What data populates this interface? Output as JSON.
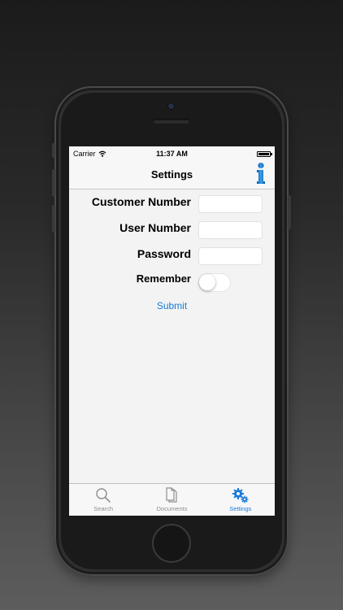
{
  "status": {
    "carrier": "Carrier",
    "time": "11:37 AM"
  },
  "nav": {
    "title": "Settings",
    "info_icon": "info-icon"
  },
  "form": {
    "customer_label": "Customer Number",
    "customer_value": "",
    "user_label": "User Number",
    "user_value": "",
    "password_label": "Password",
    "password_value": "",
    "remember_label": "Remember",
    "remember_on": false,
    "submit_label": "Submit"
  },
  "tabs": [
    {
      "label": "Search",
      "icon": "magnifier-icon",
      "active": false
    },
    {
      "label": "Documents",
      "icon": "documents-icon",
      "active": false
    },
    {
      "label": "Settings",
      "icon": "gears-icon",
      "active": true
    }
  ],
  "colors": {
    "accent": "#1a7ad9",
    "background": "#f3f3f3"
  }
}
